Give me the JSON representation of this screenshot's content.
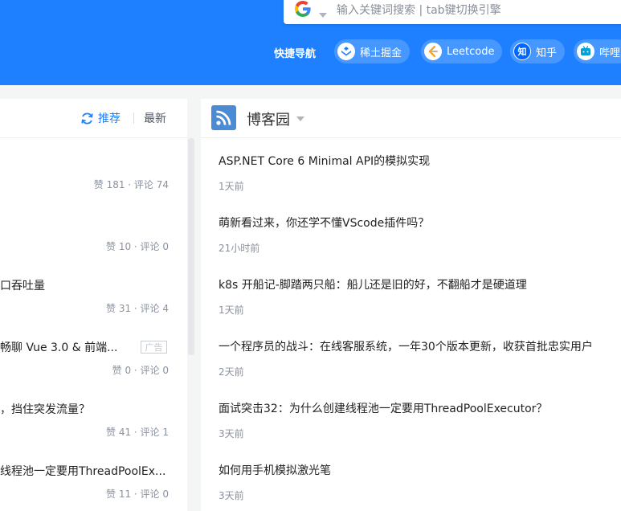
{
  "search": {
    "placeholder": "输入关键词搜索 | tab键切换引擎",
    "engine_icon": "google-icon"
  },
  "quicknav": {
    "label": "快捷导航",
    "items": [
      {
        "label": "稀土掘金",
        "icon": "juejin-icon"
      },
      {
        "label": "Leetcode",
        "icon": "leetcode-icon"
      },
      {
        "label": "知乎",
        "icon": "zhihu-icon"
      },
      {
        "label": "哔哩",
        "icon": "bilibili-icon"
      }
    ]
  },
  "feed": {
    "tabs": {
      "recommend": "推荐",
      "latest": "最新"
    },
    "items": [
      {
        "title": "",
        "meta": "赞 181 · 评论 74"
      },
      {
        "title": "",
        "meta": "赞 10 · 评论 0"
      },
      {
        "title": "口吞吐量",
        "meta": "赞 31 · 评论 4"
      },
      {
        "title": "畅聊 Vue 3.0 & 前端...",
        "meta": "赞 0 · 评论 0",
        "ad": "广告"
      },
      {
        "title": "，挡住突发流量？",
        "meta": "赞 41 · 评论 1"
      },
      {
        "title": "线程池一定要用ThreadPoolEx...",
        "meta": "赞 11 · 评论 0"
      }
    ]
  },
  "blog": {
    "source_title": "博客园",
    "source_icon": "rss-icon",
    "posts": [
      {
        "title": "ASP.NET Core 6 Minimal API的模拟实现",
        "time": "1天前"
      },
      {
        "title": "萌新看过来，你还学不懂VScode插件吗？",
        "time": "21小时前"
      },
      {
        "title": "k8s 开船记-脚踏两只船：船儿还是旧的好，不翻船才是硬道理",
        "time": "1天前"
      },
      {
        "title": "一个程序员的战斗：在线客服系统，一年30个版本更新，收获首批忠实用户",
        "time": "2天前"
      },
      {
        "title": "面试突击32：为什么创建线程池一定要用ThreadPoolExecutor？",
        "time": "3天前"
      },
      {
        "title": "如何用手机模拟激光笔",
        "time": "3天前"
      }
    ]
  },
  "colors": {
    "accent": "#1e80ff",
    "meta": "#8a919f"
  }
}
